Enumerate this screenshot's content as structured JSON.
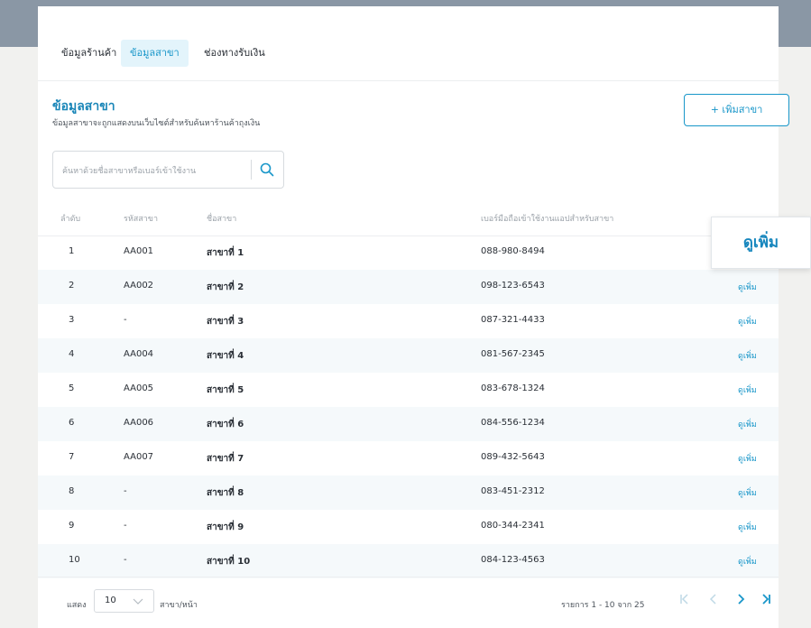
{
  "tabs": [
    {
      "label": "ข้อมูลร้านค้า",
      "active": false
    },
    {
      "label": "ข้อมูลสาขา",
      "active": true
    },
    {
      "label": "ช่องทางรับเงิน",
      "active": false
    }
  ],
  "section": {
    "title": "ข้อมูลสาขา",
    "subtitle": "ข้อมูลสาขาจะถูกแสดงบนเว็บไซต์สำหรับค้นหาร้านค้าถุงเงิน"
  },
  "add_button": "+ เพิ่มสาขา",
  "search": {
    "placeholder": "ค้นหาด้วยชื่อสาขาหรือเบอร์เข้าใช้งาน"
  },
  "table": {
    "headers": [
      "ลำดับ",
      "รหัสสาขา",
      "ชื่อสาขา",
      "เบอร์มือถือเข้าใช้งานแอปสำหรับสาขา"
    ],
    "more_label": "ดูเพิ่ม",
    "rows": [
      {
        "no": "1",
        "code": "AA001",
        "name": "สาขาที่ 1",
        "phone": "088-980-8494"
      },
      {
        "no": "2",
        "code": "AA002",
        "name": "สาขาที่ 2",
        "phone": "098-123-6543"
      },
      {
        "no": "3",
        "code": "-",
        "name": "สาขาที่ 3",
        "phone": "087-321-4433"
      },
      {
        "no": "4",
        "code": "AA004",
        "name": "สาขาที่ 4",
        "phone": "081-567-2345"
      },
      {
        "no": "5",
        "code": "AA005",
        "name": "สาขาที่ 5",
        "phone": "083-678-1324"
      },
      {
        "no": "6",
        "code": "AA006",
        "name": "สาขาที่ 6",
        "phone": "084-556-1234"
      },
      {
        "no": "7",
        "code": "AA007",
        "name": "สาขาที่ 7",
        "phone": "089-432-5643"
      },
      {
        "no": "8",
        "code": "-",
        "name": "สาขาที่ 8",
        "phone": "083-451-2312"
      },
      {
        "no": "9",
        "code": "-",
        "name": "สาขาที่ 9",
        "phone": "080-344-2341"
      },
      {
        "no": "10",
        "code": "-",
        "name": "สาขาที่ 10",
        "phone": "084-123-4563"
      }
    ]
  },
  "popup": {
    "label": "ดูเพิ่ม"
  },
  "footer": {
    "show_label": "แสดง",
    "page_size": "10",
    "per_page_label": "สาขา/หน้า",
    "range_text": "รายการ 1 - 10 จาก 25"
  },
  "colors": {
    "accent": "#1896c9",
    "active_tab_bg": "#e3f4fb",
    "alt_row": "#f5f9fb"
  },
  "icons": {
    "search": "search-icon",
    "chevron": "chevron-down-icon",
    "pagination": [
      "first-page-icon",
      "prev-page-icon",
      "next-page-icon",
      "last-page-icon"
    ]
  }
}
